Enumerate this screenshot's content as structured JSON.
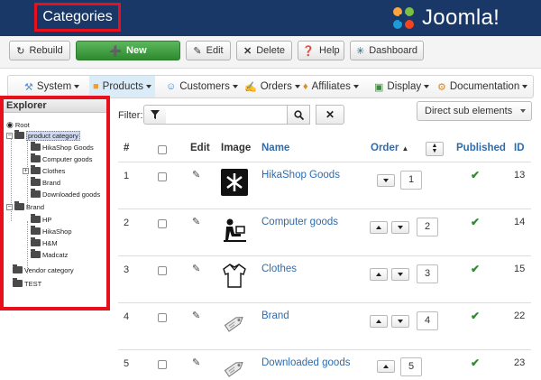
{
  "header": {
    "page_title": "Categories",
    "brand": "Joomla!",
    "colors": {
      "header_bg": "#1a3867",
      "highlight": "#e8101a"
    }
  },
  "toolbar": {
    "rebuild": "Rebuild",
    "new": "New",
    "edit": "Edit",
    "delete": "Delete",
    "help": "Help",
    "dashboard": "Dashboard"
  },
  "nav": {
    "items": [
      {
        "label": "System",
        "icon": "tools-icon"
      },
      {
        "label": "Products",
        "icon": "box-icon",
        "active": true
      },
      {
        "label": "Customers",
        "icon": "users-icon"
      },
      {
        "label": "Orders",
        "icon": "orders-icon"
      },
      {
        "label": "Affiliates",
        "icon": "affiliate-icon"
      },
      {
        "label": "Display",
        "icon": "display-icon"
      },
      {
        "label": "Documentation",
        "icon": "help-gear-icon"
      }
    ]
  },
  "explorer": {
    "title": "Explorer",
    "nodes": {
      "root": "Root",
      "product_category": "product category",
      "hikashop_goods": "HikaShop Goods",
      "computer_goods": "Computer goods",
      "clothes": "Clothes",
      "brand_child": "Brand",
      "downloaded_goods": "Downloaded goods",
      "brand": "Brand",
      "hp": "HP",
      "hikashop": "HikaShop",
      "hm": "H&M",
      "madcatz": "Madcatz",
      "vendor_category": "Vendor category",
      "test": "TEST"
    }
  },
  "filter": {
    "label": "Filter:",
    "value": "",
    "select_value": "Direct sub elements"
  },
  "table": {
    "headers": {
      "num": "#",
      "edit": "Edit",
      "image": "Image",
      "name": "Name",
      "order": "Order",
      "published": "Published",
      "id": "ID"
    },
    "rows": [
      {
        "num": "1",
        "name": "HikaShop Goods",
        "order": "1",
        "id": "13",
        "image": "hikashop-logo-icon"
      },
      {
        "num": "2",
        "name": "Computer goods",
        "order": "2",
        "id": "14",
        "image": "computer-user-icon"
      },
      {
        "num": "3",
        "name": "Clothes",
        "order": "3",
        "id": "15",
        "image": "shirt-icon"
      },
      {
        "num": "4",
        "name": "Brand",
        "order": "4",
        "id": "22",
        "image": "price-tag-icon"
      },
      {
        "num": "5",
        "name": "Downloaded goods",
        "order": "5",
        "id": "23",
        "image": "price-tag-icon"
      }
    ]
  }
}
